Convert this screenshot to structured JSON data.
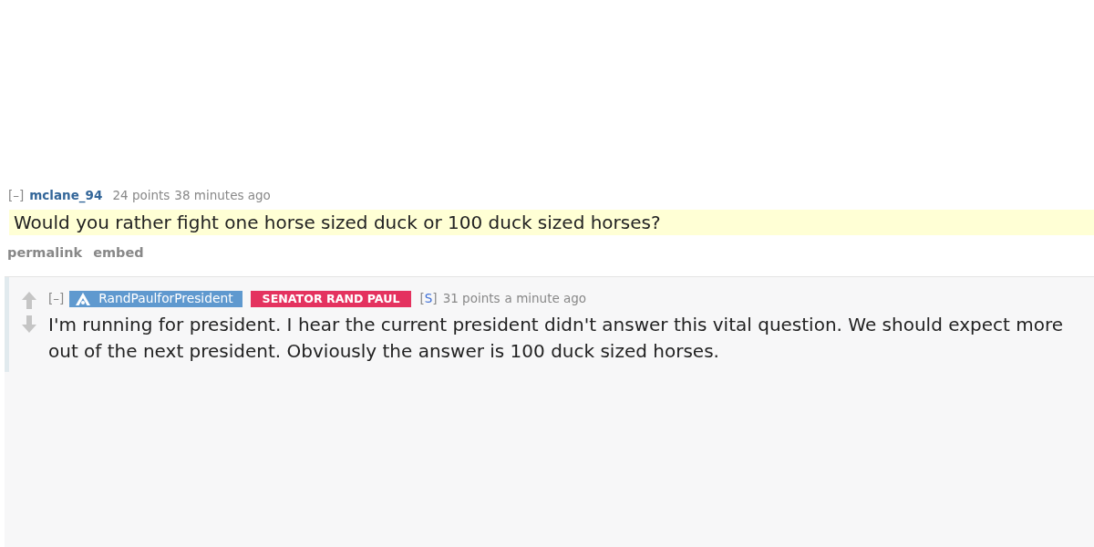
{
  "comments": [
    {
      "collapse_toggle": "[–]",
      "author": "mclane_94",
      "score": "24 points",
      "time": "38 minutes ago",
      "body": "Would you rather fight one horse sized duck or 100 duck sized horses?",
      "highlighted": true,
      "actions": [
        "permalink",
        "embed"
      ],
      "replies": [
        {
          "collapse_toggle": "[–]",
          "vote_arrows": true,
          "author": "RandPaulforPresident",
          "author_highlighted": true,
          "flair": "SENATOR RAND PAUL",
          "submitter_tag": [
            "[",
            "S",
            "]"
          ],
          "score": "31 points",
          "time": "a minute ago",
          "body": "I'm running for president. I hear the current president didn't answer this vital question. We should expect more out of the next president. Obviously the answer is 100 duck sized horses.",
          "highlighted": false
        }
      ]
    }
  ]
}
